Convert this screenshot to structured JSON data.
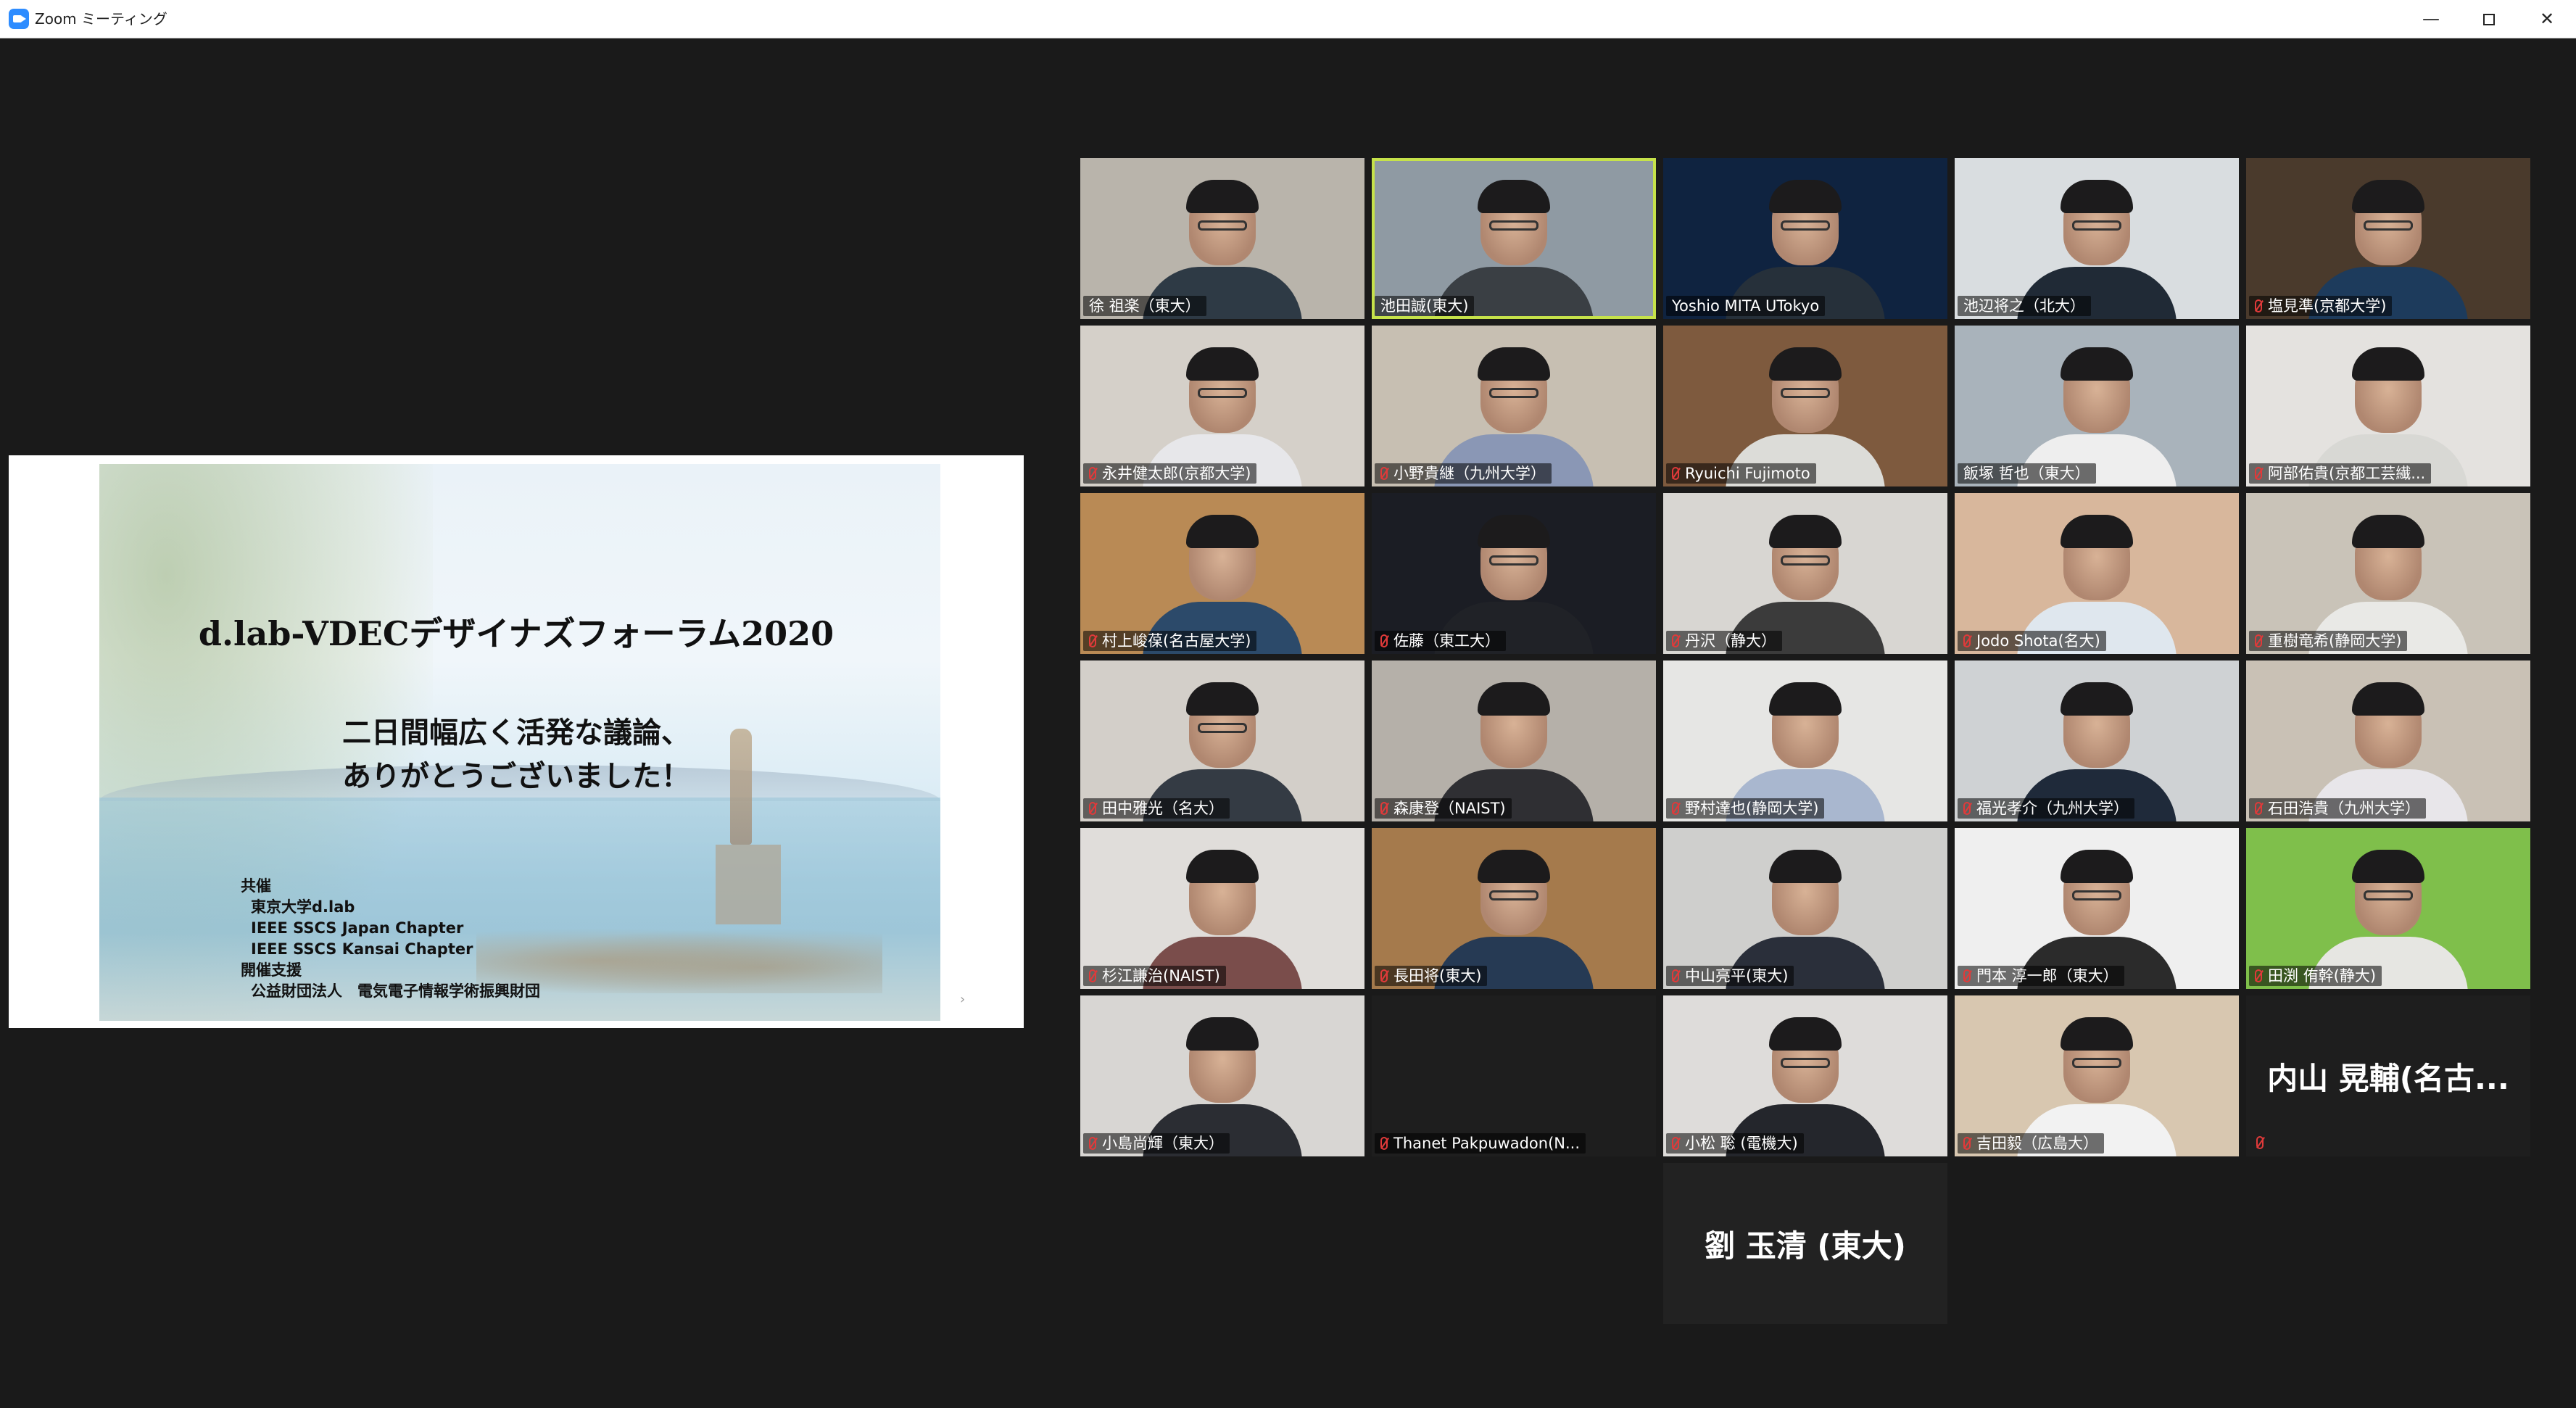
{
  "window": {
    "title": "Zoom ミーティング",
    "minimize": "—",
    "close": "✕"
  },
  "slide": {
    "title": "d.lab-VDECデザイナズフォーラム2020",
    "subtitle_line1": "二日間幅広く活発な議論、",
    "subtitle_line2": "ありがとうございました！",
    "credits": [
      "共催",
      "東京大学d.lab",
      "IEEE SSCS Japan Chapter",
      "IEEE SSCS Kansai Chapter",
      "開催支援",
      "公益財団法人　電気電子情報学術振興財団"
    ],
    "chevron": "›"
  },
  "participants": [
    {
      "name": "徐 祖楽（東大）",
      "muted": false,
      "active": false,
      "bg": "#b9b4ab",
      "shirt": "#2e3a45",
      "glasses": true
    },
    {
      "name": "池田誠(東大)",
      "muted": false,
      "active": true,
      "bg": "#8f9aa3",
      "shirt": "#3a3f44",
      "glasses": true
    },
    {
      "name": "Yoshio MITA UTokyo",
      "muted": false,
      "active": false,
      "bg": "#0f2340",
      "shirt": "#26303a",
      "glasses": true
    },
    {
      "name": "池辺将之（北大）",
      "muted": false,
      "active": false,
      "bg": "#d9dde0",
      "shirt": "#202a36",
      "glasses": true
    },
    {
      "name": "塩見準(京都大学)",
      "muted": true,
      "active": false,
      "bg": "#4a3a2c",
      "shirt": "#1d3b5c",
      "glasses": true
    },
    {
      "name": "永井健太郎(京都大学)",
      "muted": true,
      "active": false,
      "bg": "#d5d0c9",
      "shirt": "#e7e7ea",
      "glasses": true
    },
    {
      "name": "小野貴継（九州大学）",
      "muted": true,
      "active": false,
      "bg": "#c7bfb2",
      "shirt": "#8a97b5",
      "glasses": true
    },
    {
      "name": "Ryuichi Fujimoto",
      "muted": true,
      "active": false,
      "bg": "#7e5a3e",
      "shirt": "#dcdcd8",
      "glasses": true
    },
    {
      "name": "飯塚 哲也（東大）",
      "muted": false,
      "active": false,
      "bg": "#a9b3bb",
      "shirt": "#eeeeee",
      "glasses": false
    },
    {
      "name": "阿部佑貴(京都工芸繊...",
      "muted": true,
      "active": false,
      "bg": "#e4e2df",
      "shirt": "#d8d8d4",
      "glasses": false
    },
    {
      "name": "村上峻葆(名古屋大学)",
      "muted": true,
      "active": false,
      "bg": "#b98a55",
      "shirt": "#2c4a6a",
      "glasses": false
    },
    {
      "name": "佐藤（東工大）",
      "muted": true,
      "active": false,
      "bg": "#1b1d24",
      "shirt": "#202227",
      "glasses": true
    },
    {
      "name": "丹沢（静大）",
      "muted": true,
      "active": false,
      "bg": "#d8d6d2",
      "shirt": "#3b3b3b",
      "glasses": true
    },
    {
      "name": "Jodo Shota(名大)",
      "muted": true,
      "active": false,
      "bg": "#d8b79c",
      "shirt": "#dfe7ee",
      "glasses": false
    },
    {
      "name": "重樹竜希(静岡大学)",
      "muted": true,
      "active": false,
      "bg": "#c9c3b8",
      "shirt": "#e9e9e6",
      "glasses": false
    },
    {
      "name": "田中雅光（名大）",
      "muted": true,
      "active": false,
      "bg": "#d3cfc9",
      "shirt": "#343b44",
      "glasses": true
    },
    {
      "name": "森康登（NAIST)",
      "muted": true,
      "active": false,
      "bg": "#b5b0a9",
      "shirt": "#2f2f33",
      "glasses": false
    },
    {
      "name": "野村達也(静岡大学)",
      "muted": true,
      "active": false,
      "bg": "#e6e6e4",
      "shirt": "#a9b7cf",
      "glasses": false
    },
    {
      "name": "福光孝介（九州大学）",
      "muted": true,
      "active": false,
      "bg": "#cfd2d4",
      "shirt": "#1f2a3a",
      "glasses": false
    },
    {
      "name": "石田浩貴（九州大学）",
      "muted": true,
      "active": false,
      "bg": "#c9c1b5",
      "shirt": "#e8e6ea",
      "glasses": false
    },
    {
      "name": "杉江謙治(NAIST)",
      "muted": true,
      "active": false,
      "bg": "#e0ddda",
      "shirt": "#7a4d4b",
      "glasses": false
    },
    {
      "name": "長田将(東大)",
      "muted": true,
      "active": false,
      "bg": "#a57a4c",
      "shirt": "#263a54",
      "glasses": true
    },
    {
      "name": "中山亮平(東大)",
      "muted": true,
      "active": false,
      "bg": "#cfcfcd",
      "shirt": "#2a2f3a",
      "glasses": false
    },
    {
      "name": "門本 淳一郎（東大）",
      "muted": true,
      "active": false,
      "bg": "#efefef",
      "shirt": "#2b2b2b",
      "glasses": true
    },
    {
      "name": "田渕 侑幹(静大)",
      "muted": true,
      "active": false,
      "bg": "#7fbf4b",
      "shirt": "#e6e6e2",
      "glasses": true
    },
    {
      "name": "小島尚輝（東大）",
      "muted": true,
      "active": false,
      "bg": "#d8d6d3",
      "shirt": "#2b2d33",
      "glasses": false
    },
    {
      "name": "Thanet Pakpuwadon(N...",
      "muted": true,
      "active": false,
      "bg": "#1e1e1e",
      "shirt": "",
      "glasses": false,
      "video_off": true
    },
    {
      "name": "小松 聡 (電機大)",
      "muted": true,
      "active": false,
      "bg": "#dedcda",
      "shirt": "#24262c",
      "glasses": true
    },
    {
      "name": "吉田毅（広島大）",
      "muted": true,
      "active": false,
      "bg": "#d8c7b0",
      "shirt": "#f2f2f2",
      "glasses": true
    },
    {
      "name": "",
      "display_name": "内山 晃輔(名古...",
      "muted": true,
      "active": false,
      "bg": "#1e1e1e",
      "shirt": "",
      "glasses": false,
      "video_off": true
    },
    {
      "name": "",
      "display_name": "劉 玉清 (東大)",
      "muted": false,
      "active": false,
      "bg": "#222222",
      "shirt": "",
      "glasses": false,
      "video_off": true
    }
  ]
}
